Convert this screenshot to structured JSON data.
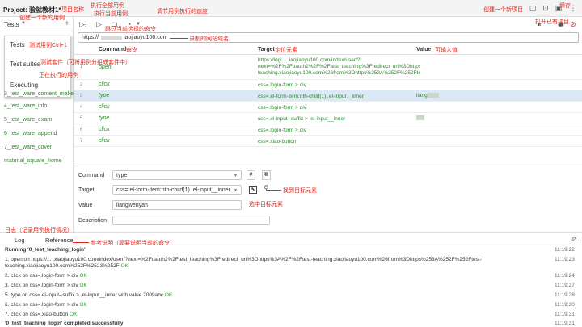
{
  "project": {
    "label": "Project:",
    "name": "验就教材1*"
  },
  "sidebar": {
    "title": "Tests",
    "dropdown": [
      "Tests",
      "Test suites",
      "Executing"
    ],
    "tests": [
      "3_test_ware_content_make",
      "4_test_ware_info",
      "5_test_ware_exam",
      "6_test_ware_append",
      "7_test_ware_cover",
      "material_square_home"
    ]
  },
  "url": {
    "prefix": "https://",
    "suffix": "iaojiaoyu100.com"
  },
  "table": {
    "headers": {
      "command": "Command",
      "target": "Target",
      "value": "Value"
    },
    "rows": [
      {
        "num": "1",
        "command": "open",
        "target": "https://logi... .iaojiaoyu100.com/index/user/?next=%2F%2Foauth2%2F%2Ftest_teaching%3Fredirect_uri%3Dhttps%3A%2F%2Ftest-teaching.xiaojiaoyu100.com%26from%3Dhttps%253A%252F%252Ftest-teach...",
        "value": ""
      },
      {
        "num": "2",
        "command": "click",
        "target": "css=.login-form > div",
        "value": ""
      },
      {
        "num": "3",
        "command": "type",
        "target": "css=.el-form-item:nth-child(1) .el-input__inner",
        "value": "liang"
      },
      {
        "num": "4",
        "command": "click",
        "target": "css=.login-form > div",
        "value": ""
      },
      {
        "num": "5",
        "command": "type",
        "target": "css=.el-input--suffix > .el-input__inner",
        "value": ""
      },
      {
        "num": "6",
        "command": "click",
        "target": "css=.login-form > div",
        "value": ""
      },
      {
        "num": "7",
        "command": "click",
        "target": "css=.xiao-button",
        "value": ""
      }
    ]
  },
  "editor": {
    "command_label": "Command",
    "command_value": "type",
    "target_label": "Target",
    "target_value": "css=.el-form-item:nth-child(1) .el-input__inner",
    "value_label": "Value",
    "value_value": "liangwenyan",
    "description_label": "Description"
  },
  "log": {
    "tabs": [
      "Log",
      "Reference"
    ],
    "running": "Running '0_test_teaching_login'",
    "running_time": "11:19:22",
    "lines": [
      {
        "text": "1.  open on https://... .xiaojiaoyu100.com/index/user/?next=%2Foauth2%2Ftest_teaching%3Fredirect_uri%3Dhttps%3A%2F%2Ftest-teaching.xiaojiaoyu100.com%26from%3Dhttps%253A%252F%252Ftest-teaching.xiaojiaoyu100.com%252F%2523%252F",
        "ok": "OK",
        "time": "11:19:23"
      },
      {
        "text": "2.  click on css=.login-form > div",
        "ok": "OK",
        "time": "11:19:24"
      },
      {
        "text": "3.  click on css=.login-form > div",
        "ok": "OK",
        "time": "11:19:27"
      },
      {
        "text": "5.  type on css=.el-input--suffix > .el-input__inner with value 2009abc",
        "ok": "OK",
        "time": "11:19:28"
      },
      {
        "text": "6.  click on css=.login-form > div",
        "ok": "OK",
        "time": "11:19:30"
      },
      {
        "text": "7.  click on css=.xiao-button",
        "ok": "OK",
        "time": "11:19:31"
      }
    ],
    "completed": "'0_test_teaching_login' completed successfully",
    "completed_time": "11:19:31"
  },
  "annotations": {
    "project_name": "项目名称",
    "new_case": "创建一个新的用例",
    "run_all": "执行全部用例",
    "run_current": "执行当前用例",
    "speed": "调节用例执行的速度",
    "new_project": "创建一个新项目",
    "save": "保存",
    "open_project": "打开已有项目",
    "skip": "跳过当前选择的命令",
    "recorded_domain": "录制的网站域名",
    "command_ann": "命令",
    "locate": "定位元素",
    "input_value": "可输入值",
    "test_cases": "测试用例Ctrl+1",
    "test_suites": "测试套件（可将用例分组成套件中）",
    "executing": "正在执行的用例",
    "find_target": "找到目标元素",
    "select_target": "选中目标元素",
    "log_ann": "日志（记录用例执行情况）",
    "reference_ann": "参考说明（简要说明当前的命令）"
  },
  "colors": {
    "accent": "#e0261b",
    "ok": "#3aa23a",
    "selected_row": "#dce8f4"
  }
}
